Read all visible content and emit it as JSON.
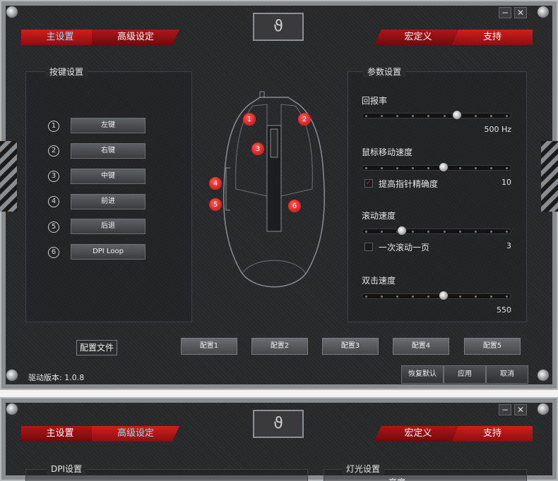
{
  "window_controls": {
    "minimize": "−",
    "close": "✕"
  },
  "logo": {
    "icon": "dragon-logo-icon",
    "glyph": "ϑ"
  },
  "tabs": {
    "main_settings": "主设置",
    "advanced_settings": "高级设定",
    "macro": "宏定义",
    "support": "支持"
  },
  "key_settings": {
    "title": "按键设置",
    "keys": [
      {
        "num": "1",
        "label": "左键"
      },
      {
        "num": "2",
        "label": "右键"
      },
      {
        "num": "3",
        "label": "中键"
      },
      {
        "num": "4",
        "label": "前进"
      },
      {
        "num": "5",
        "label": "后退"
      },
      {
        "num": "6",
        "label": "DPI Loop"
      }
    ]
  },
  "mouse_diagram": {
    "badges": [
      "1",
      "2",
      "3",
      "4",
      "5",
      "6"
    ]
  },
  "params": {
    "title": "参数设置",
    "report_rate": {
      "label": "回报率",
      "value": "500 Hz",
      "level": 0.65
    },
    "pointer_speed": {
      "label": "鼠标移动速度",
      "level": 0.55,
      "checkbox_label": "提高指针精确度",
      "checked": true,
      "value": "10"
    },
    "scroll_speed": {
      "label": "滚动速度",
      "level": 0.25,
      "checkbox_label": "一次滚动一页",
      "checked": false,
      "value": "3"
    },
    "double_click": {
      "label": "双击速度",
      "level": 0.55,
      "value": "550"
    }
  },
  "profile_file": "配置文件",
  "configs": [
    "配置1",
    "配置2",
    "配置3",
    "配置4",
    "配置5"
  ],
  "active_config": 0,
  "footer": {
    "version": "驱动版本: 1.0.8",
    "restore_default": "恢复默认",
    "apply": "应用",
    "cancel": "取消"
  },
  "window2": {
    "dpi_settings": "DPI设置",
    "light_settings": "灯光设置",
    "partial_label": "亮度"
  }
}
